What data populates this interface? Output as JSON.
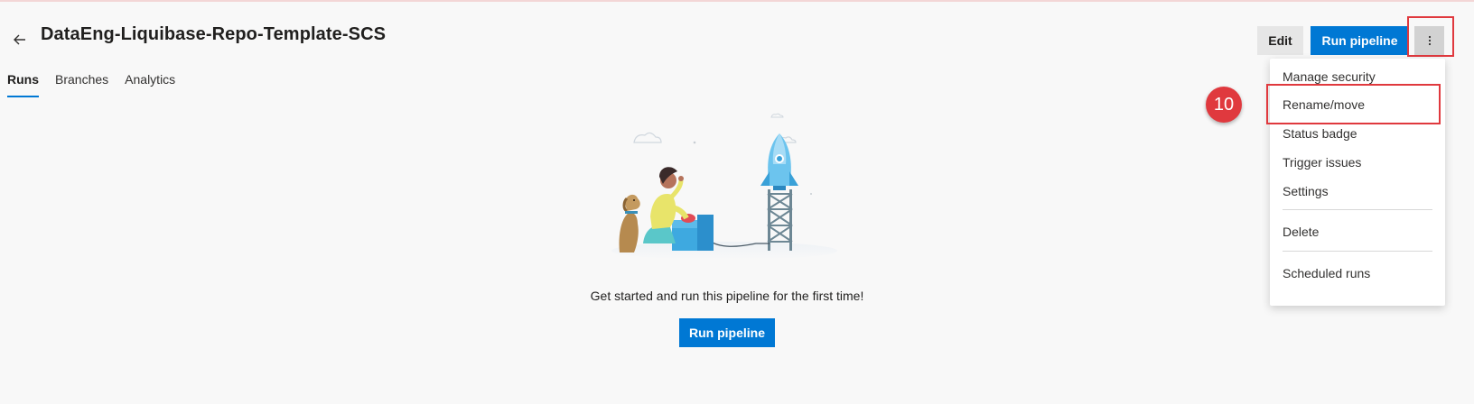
{
  "header": {
    "title": "DataEng-Liquibase-Repo-Template-SCS",
    "back_icon": "arrow-left-icon"
  },
  "tabs": [
    {
      "label": "Runs",
      "active": true
    },
    {
      "label": "Branches",
      "active": false
    },
    {
      "label": "Analytics",
      "active": false
    }
  ],
  "toolbar": {
    "edit_label": "Edit",
    "run_label": "Run pipeline",
    "more_icon": "more-vertical-icon"
  },
  "menu": {
    "items": [
      {
        "label": "Manage security"
      },
      {
        "label": "Rename/move"
      },
      {
        "label": "Status badge"
      },
      {
        "label": "Trigger issues"
      },
      {
        "label": "Settings"
      },
      {
        "label": "Delete"
      },
      {
        "label": "Scheduled runs"
      }
    ]
  },
  "annotation": {
    "step_number": "10"
  },
  "empty_state": {
    "message": "Get started and run this pipeline for the first time!",
    "button_label": "Run pipeline",
    "illustration": "rocket-launch-illustration"
  },
  "colors": {
    "accent": "#0078d4",
    "annotation": "#e0393e",
    "background": "#f8f8f8"
  }
}
